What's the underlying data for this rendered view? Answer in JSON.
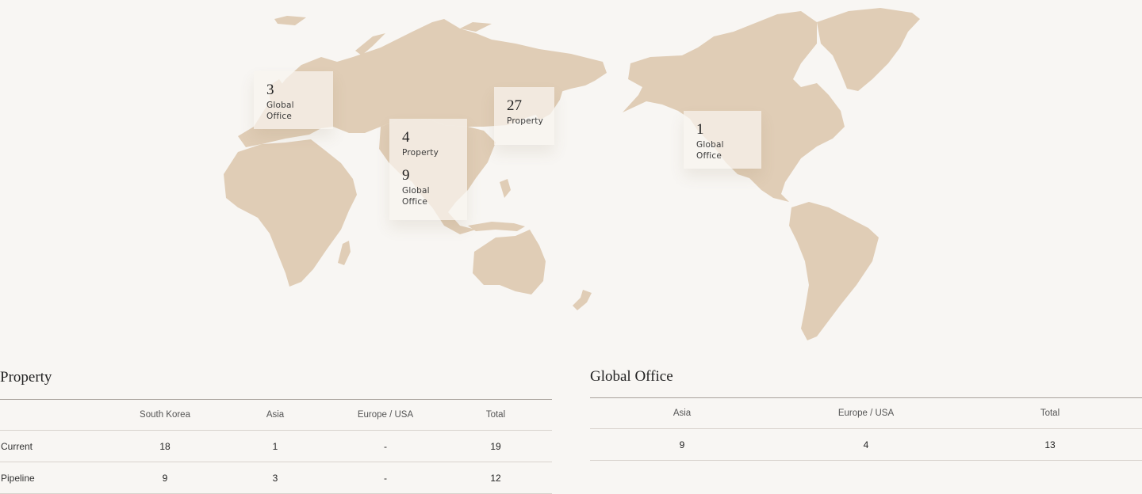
{
  "colors": {
    "background": "#f8f6f3",
    "land": "#e0cdb6"
  },
  "map": {
    "callouts": [
      {
        "region": "europe",
        "stats": [
          {
            "value": "3",
            "label": "Global Office"
          }
        ]
      },
      {
        "region": "asia",
        "stats": [
          {
            "value": "4",
            "label": "Property"
          },
          {
            "value": "9",
            "label": "Global Office"
          }
        ]
      },
      {
        "region": "korea",
        "stats": [
          {
            "value": "27",
            "label": "Property"
          }
        ]
      },
      {
        "region": "usa",
        "stats": [
          {
            "value": "1",
            "label": "Global Office"
          }
        ]
      }
    ]
  },
  "property": {
    "title": "Property",
    "headers": [
      "",
      "South Korea",
      "Asia",
      "Europe / USA",
      "Total"
    ],
    "rows": [
      [
        "Current",
        "18",
        "1",
        "-",
        "19"
      ],
      [
        "Pipeline",
        "9",
        "3",
        "-",
        "12"
      ]
    ]
  },
  "global_office": {
    "title": "Global Office",
    "headers": [
      "Asia",
      "Europe / USA",
      "Total"
    ],
    "rows": [
      [
        "9",
        "4",
        "13"
      ]
    ]
  }
}
